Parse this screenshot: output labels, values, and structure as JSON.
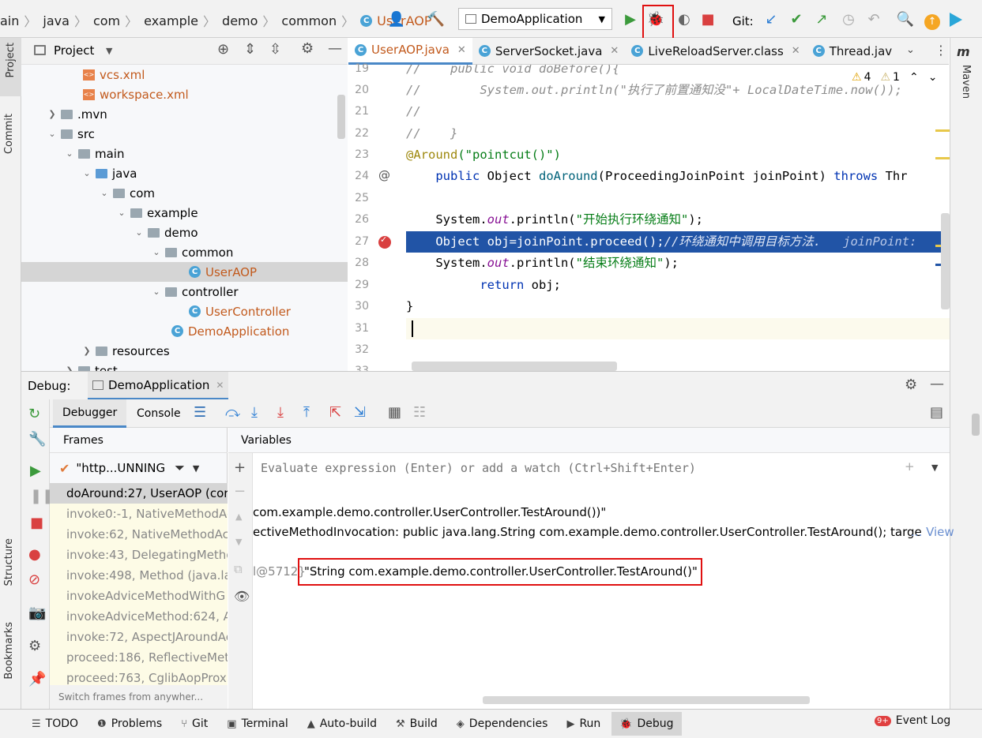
{
  "breadcrumb": [
    "ain",
    "java",
    "com",
    "example",
    "demo",
    "common",
    "UserAOP"
  ],
  "toolbar": {
    "run_config": "DemoApplication",
    "git_label": "Git:"
  },
  "project": {
    "header": "Project",
    "tree": [
      {
        "label": "vcs.xml",
        "kind": "xml"
      },
      {
        "label": "workspace.xml",
        "kind": "xml"
      },
      {
        "label": ".mvn",
        "kind": "folder"
      },
      {
        "label": "src",
        "kind": "folder"
      },
      {
        "label": "main",
        "kind": "folder"
      },
      {
        "label": "java",
        "kind": "folder"
      },
      {
        "label": "com",
        "kind": "package"
      },
      {
        "label": "example",
        "kind": "package"
      },
      {
        "label": "demo",
        "kind": "package"
      },
      {
        "label": "common",
        "kind": "package"
      },
      {
        "label": "UserAOP",
        "kind": "class"
      },
      {
        "label": "controller",
        "kind": "package"
      },
      {
        "label": "UserController",
        "kind": "class"
      },
      {
        "label": "DemoApplication",
        "kind": "class"
      },
      {
        "label": "resources",
        "kind": "folder"
      },
      {
        "label": "test",
        "kind": "folder"
      }
    ]
  },
  "editor": {
    "tabs": [
      "UserAOP.java",
      "ServerSocket.java",
      "LiveReloadServer.class",
      "Thread.jav"
    ],
    "warnings": "4",
    "weak_warnings": "1",
    "line_numbers": [
      "19",
      "20",
      "21",
      "22",
      "23",
      "24",
      "25",
      "26",
      "27",
      "28",
      "29",
      "30",
      "31",
      "32",
      "33"
    ],
    "lines": {
      "l19": "//    public void doBefore(){",
      "l20": "//        System.out.println(\"执行了前置通知没\"+ LocalDateTime.now());",
      "l21": "//",
      "l22": "//    }",
      "l23a": "@Around",
      "l23b": "(\"pointcut()\")",
      "l24a": "    public ",
      "l24b": "Object ",
      "l24c": "doAround",
      "l24d": "(ProceedingJoinPoint joinPoint) ",
      "l24e": "throws ",
      "l24f": "Thr",
      "l26a": "    System.",
      "l26b": "out",
      "l26c": ".println(",
      "l26d": "\"开始执行环绕通知\"",
      "l26e": ");",
      "l27a": "    Object obj=joinPoint.proceed();",
      "l27b": "//环绕通知中调用目标方法.",
      "l27c": "   joinPoint:",
      "l28a": "    System.",
      "l28b": "out",
      "l28c": ".println(",
      "l28d": "\"结束环绕通知\"",
      "l28e": ");",
      "l29a": "          return ",
      "l29b": "obj;",
      "l30": "}"
    }
  },
  "maven_label": "Maven",
  "left_strip": {
    "project": "Project",
    "commit": "Commit",
    "structure": "Structure",
    "bookmarks": "Bookmarks"
  },
  "debug": {
    "label": "Debug:",
    "session": "DemoApplication",
    "tabs": [
      "Debugger",
      "Console"
    ],
    "frames_header": "Frames",
    "variables_header": "Variables",
    "thread": "\"http...UNNING",
    "frames": [
      "doAround:27, UserAOP (cor",
      "invoke0:-1, NativeMethodAc",
      "invoke:62, NativeMethodAc",
      "invoke:43, DelegatingMetho",
      "invoke:498, Method (java.la",
      "invokeAdviceMethodWithG",
      "invokeAdviceMethod:624, A",
      "invoke:72, AspectJAroundAc",
      "proceed:186, ReflectiveMet",
      "proceed:763, CglibAopProx"
    ],
    "frames_footer": "Switch frames from anywher...",
    "eval_placeholder": "Evaluate expression (Enter) or add a watch (Ctrl+Shift+Enter)",
    "var_lines": [
      "com.example.demo.controller.UserController.TestAround())\"",
      "ectiveMethodInvocation: public java.lang.String com.example.demo.controller.UserController.TestAround(); targe"
    ],
    "view_link": "... View",
    "var_ref": "l@5712}",
    "var_value": "\"String com.example.demo.controller.UserController.TestAround()\""
  },
  "statusbar": [
    "TODO",
    "Problems",
    "Git",
    "Terminal",
    "Auto-build",
    "Build",
    "Dependencies",
    "Run",
    "Debug",
    "Event Log"
  ],
  "event_badge": "9+"
}
